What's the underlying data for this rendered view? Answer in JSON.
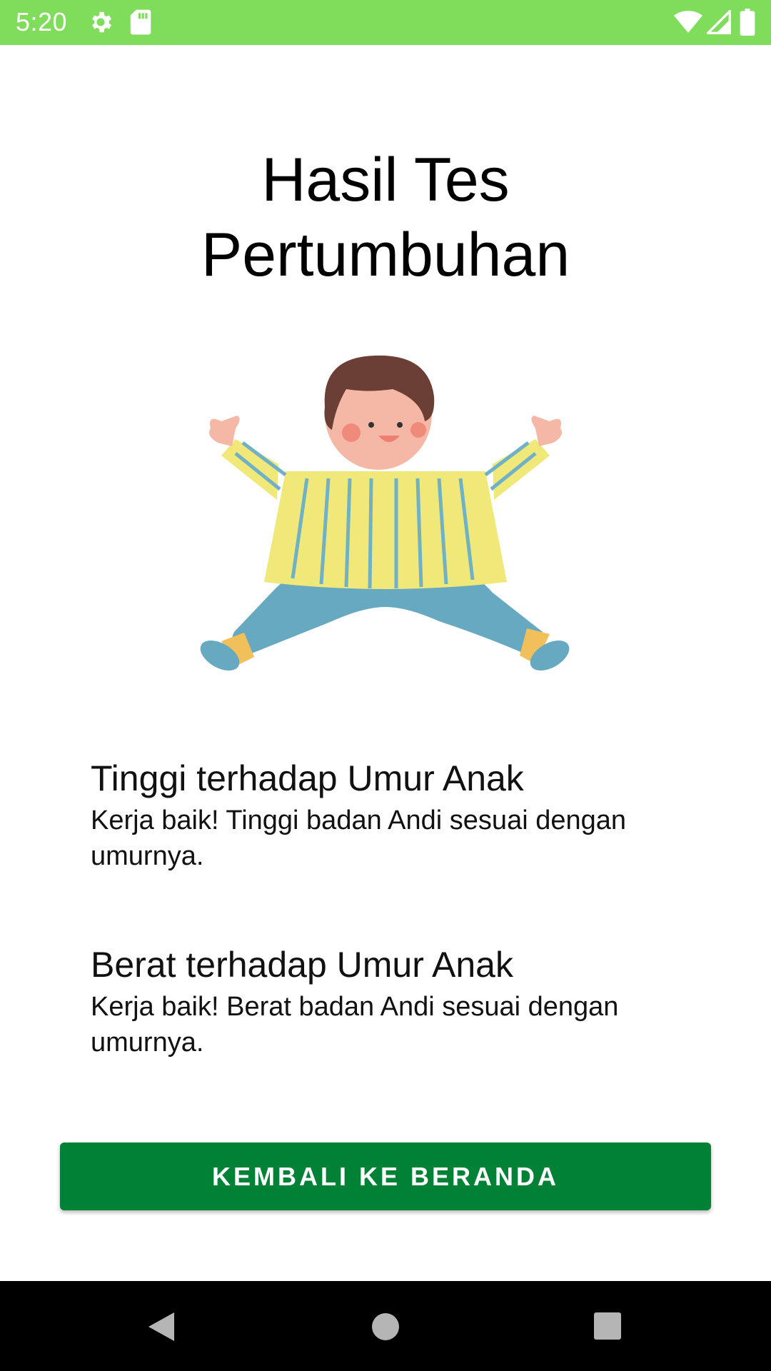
{
  "status_bar": {
    "time": "5:20",
    "icons": [
      "settings-icon",
      "sd-card-icon",
      "wifi-icon",
      "signal-icon",
      "battery-icon"
    ],
    "background_color": "#80dd5c"
  },
  "page": {
    "title_line1": "Hasil Tes",
    "title_line2": "Pertumbuhan",
    "illustration": "happy-child-jumping-illustration"
  },
  "results": [
    {
      "title": "Tinggi terhadap Umur Anak",
      "description": "Kerja baik! Tinggi badan Andi sesuai dengan umurnya."
    },
    {
      "title": "Berat terhadap Umur Anak",
      "description": "Kerja baik! Berat badan Andi sesuai dengan umurnya."
    }
  ],
  "primary_button": {
    "label": "KEMBALI KE BERANDA",
    "color": "#008236"
  },
  "nav_bar": {
    "icons": [
      "back-icon",
      "home-icon",
      "recents-icon"
    ]
  }
}
